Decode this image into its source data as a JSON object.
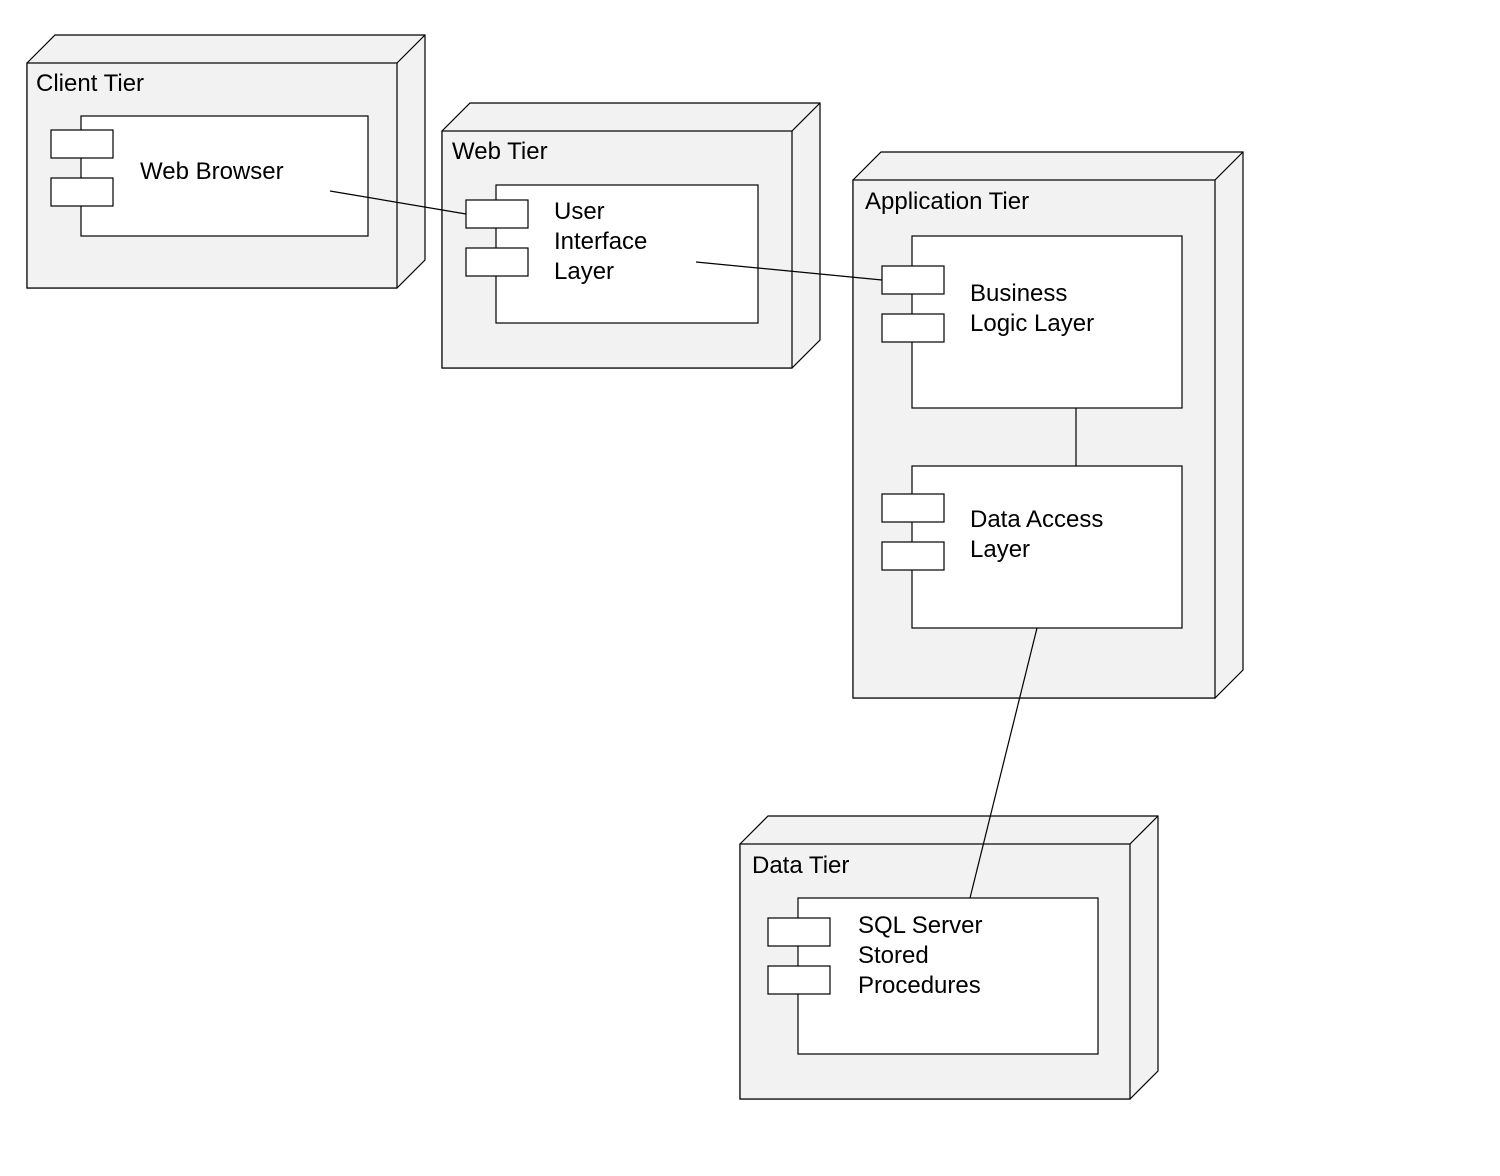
{
  "nodes": {
    "client": {
      "label": "Client Tier"
    },
    "web": {
      "label": "Web Tier"
    },
    "application": {
      "label": "Application Tier"
    },
    "data": {
      "label": "Data Tier"
    }
  },
  "components": {
    "web_browser": {
      "label_lines": [
        "Web Browser"
      ]
    },
    "ui_layer": {
      "label_lines": [
        "User",
        "Interface",
        "Layer"
      ]
    },
    "business_logic": {
      "label_lines": [
        "Business",
        "Logic Layer"
      ]
    },
    "data_access": {
      "label_lines": [
        "Data Access",
        "Layer"
      ]
    },
    "sql_stored_procs": {
      "label_lines": [
        "SQL Server",
        "Stored",
        "Procedures"
      ]
    }
  }
}
